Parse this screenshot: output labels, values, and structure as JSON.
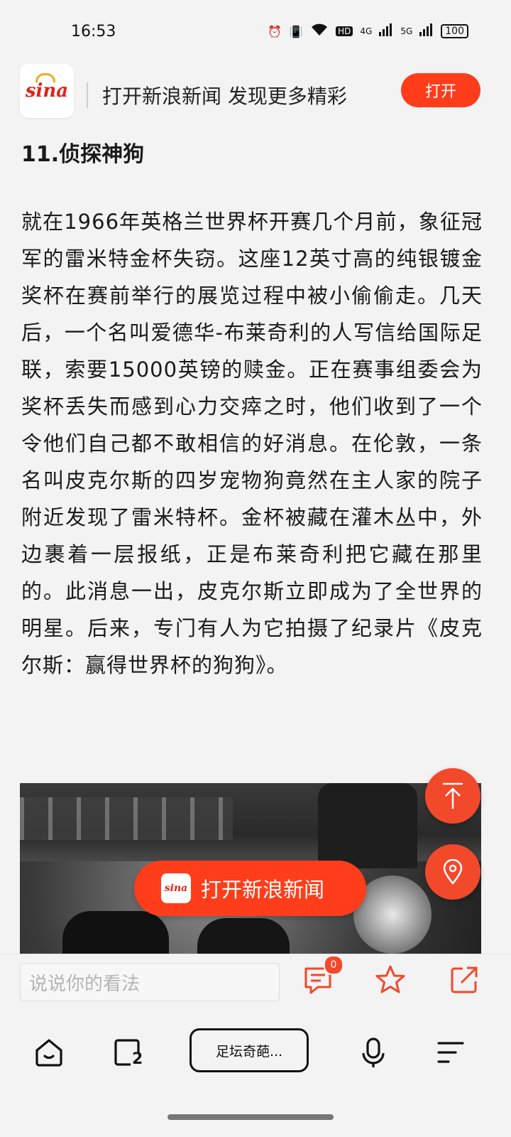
{
  "status": {
    "time": "16:53",
    "battery": "100",
    "network_labels": [
      "HD",
      "4G",
      "5G"
    ]
  },
  "banner": {
    "logo_text": "sina",
    "message": "打开新浪新闻 发现更多精彩",
    "open_label": "打开"
  },
  "article": {
    "heading": "11.侦探神狗",
    "paragraph": "就在1966年英格兰世界杯开赛几个月前，象征冠军的雷米特金杯失窃。这座12英寸高的纯银镀金奖杯在赛前举行的展览过程中被小偷偷走。几天后，一个名叫爱德华-布莱奇利的人写信给国际足联，索要15000英镑的赎金。正在赛事组委会为奖杯丢失而感到心力交瘁之时，他们收到了一个令他们自己都不敢相信的好消息。在伦敦，一条名叫皮克尔斯的四岁宠物狗竟然在主人家的院子附近发现了雷米特杯。金杯被藏在灌木丛中，外边裹着一层报纸，正是布莱奇利把它藏在那里的。此消息一出，皮克尔斯立即成为了全世界的明星。后来，专门有人为它拍摄了纪录片《皮克尔斯：赢得世界杯的狗狗》。"
  },
  "floating": {
    "open_app_label": "打开新浪新闻",
    "mini_logo": "sina"
  },
  "comment_bar": {
    "placeholder": "说说你的看法",
    "comment_count": "0"
  },
  "nav": {
    "tab_label": "足坛奇葩...",
    "tab_count": "2"
  },
  "colors": {
    "accent": "#ff3d1a",
    "brand_red": "#e2231a"
  }
}
